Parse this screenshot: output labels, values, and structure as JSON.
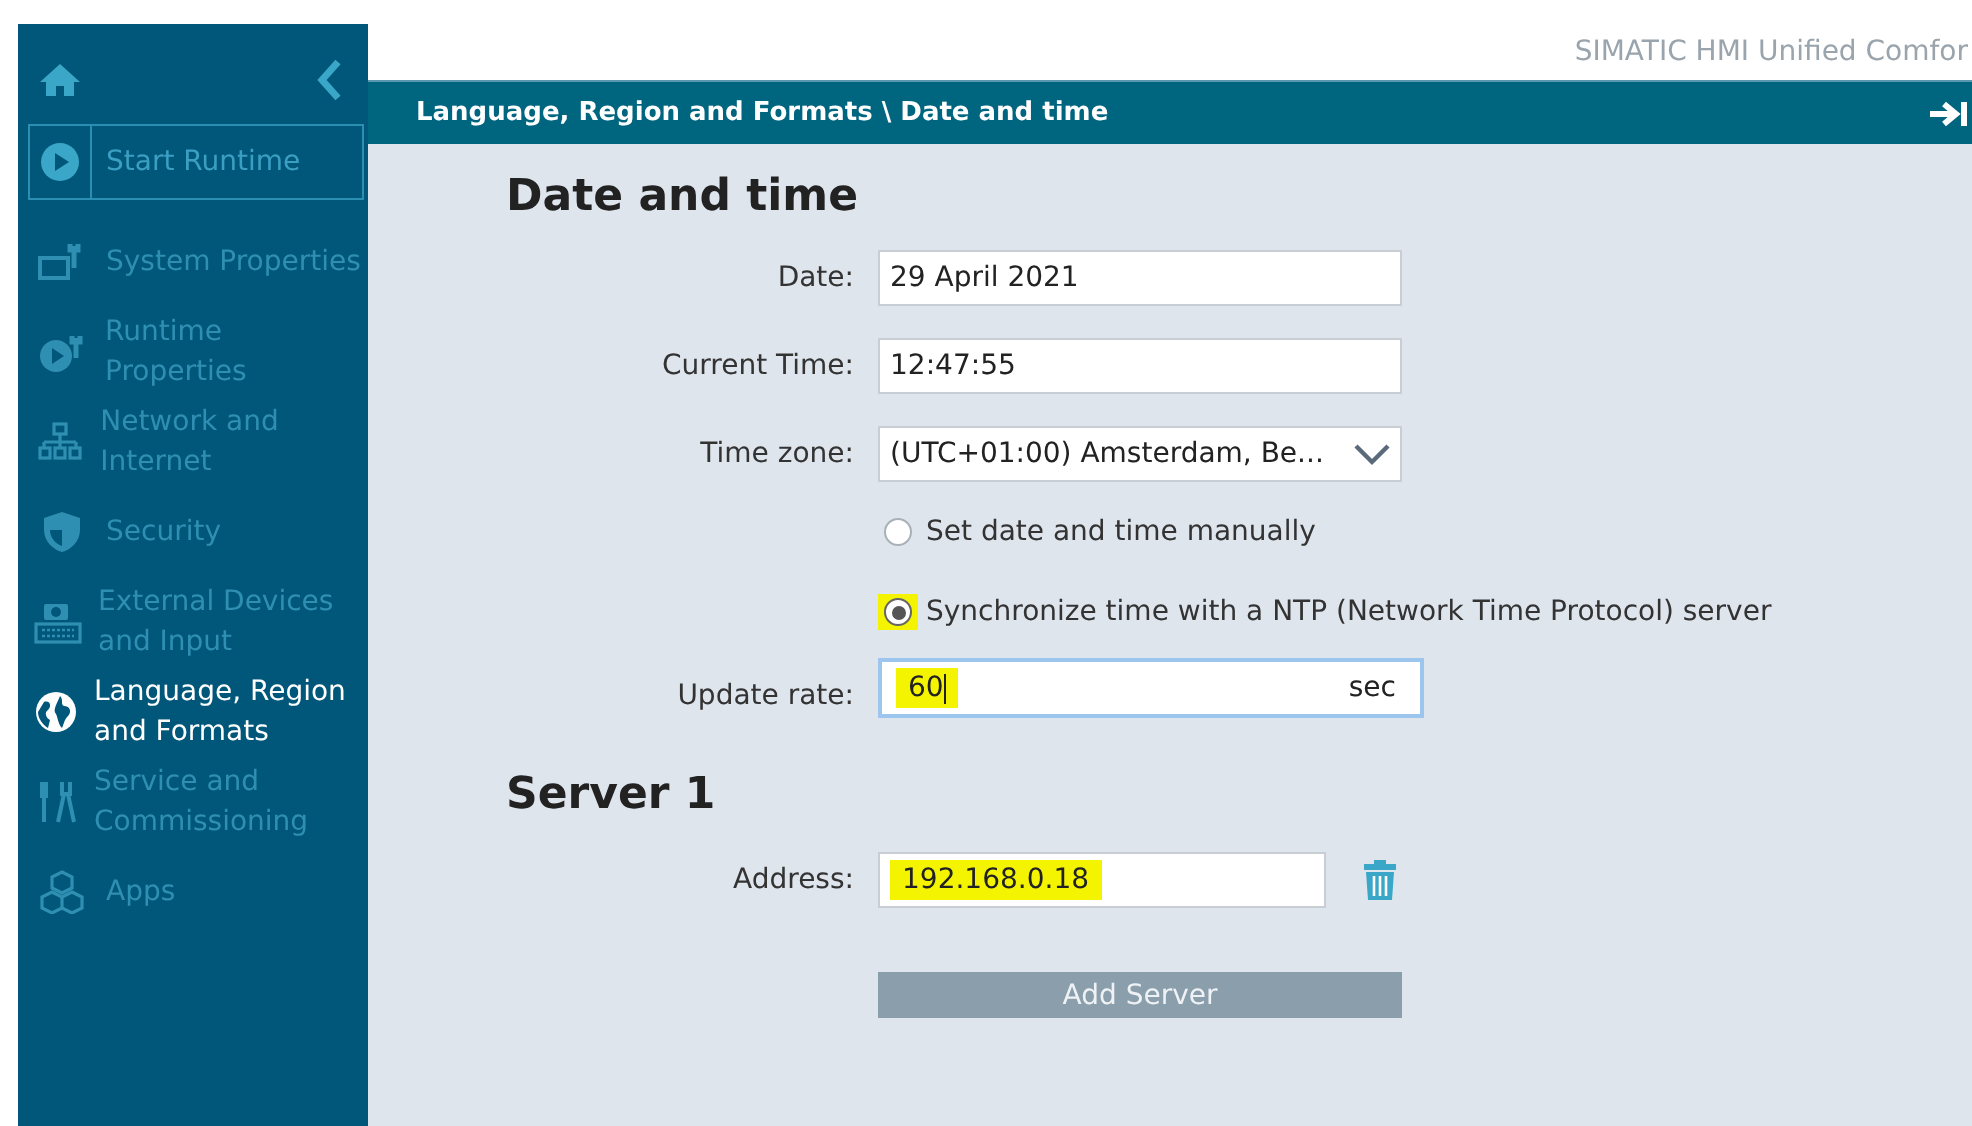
{
  "brand": "SIMATIC HMI Unified Comfor",
  "sidebar": {
    "items": [
      {
        "label": "Start Runtime",
        "kind": "button",
        "selected": false
      },
      {
        "label": "System Properties",
        "kind": "link",
        "selected": false
      },
      {
        "label": "Runtime Properties",
        "kind": "link",
        "selected": false
      },
      {
        "label": "Network and Internet",
        "kind": "link",
        "selected": false
      },
      {
        "label": "Security",
        "kind": "link",
        "selected": false
      },
      {
        "label": "External Devices and Input",
        "kind": "link",
        "selected": false
      },
      {
        "label": "Language, Region and Formats",
        "kind": "link",
        "selected": true
      },
      {
        "label": "Service and Commissioning",
        "kind": "link",
        "selected": false
      },
      {
        "label": "Apps",
        "kind": "link",
        "selected": false
      }
    ]
  },
  "breadcrumb": "Language, Region and Formats \\ Date and time",
  "section_title": "Date and time",
  "fields": [
    {
      "label": "Date:",
      "value": "29 April 2021",
      "kind": "text"
    },
    {
      "label": "Current Time:",
      "value": "12:47:55",
      "kind": "text"
    },
    {
      "label": "Time zone:",
      "value": "(UTC+01:00) Amsterdam, Be...",
      "kind": "dropdown"
    }
  ],
  "radios": [
    {
      "label": "Set date and time manually",
      "selected": false,
      "highlighted": false
    },
    {
      "label": "Synchronize time with a NTP (Network Time Protocol) server",
      "selected": true,
      "highlighted": true
    }
  ],
  "update_rate": {
    "label": "Update rate:",
    "value": "60",
    "unit": "sec",
    "focused": true,
    "highlighted": true
  },
  "server": {
    "title": "Server 1",
    "label": "Address:",
    "value": "192.168.0.18",
    "highlighted": true
  },
  "add_button": {
    "label": "Add Server",
    "disabled": true
  }
}
